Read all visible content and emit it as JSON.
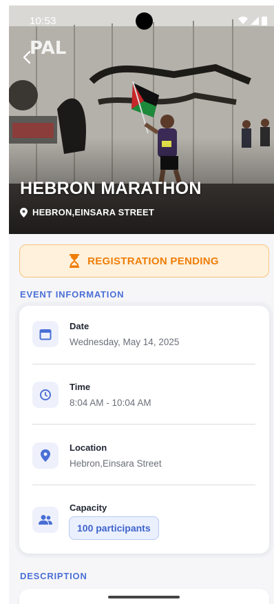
{
  "status_bar": {
    "time": "10:53"
  },
  "event": {
    "title": "HEBRON MARATHON",
    "location": "HEBRON,EINSARA STREET"
  },
  "registration": {
    "status": "REGISTRATION PENDING"
  },
  "sections": {
    "event_info": "EVENT INFORMATION",
    "description": "DESCRIPTION"
  },
  "info": {
    "date": {
      "label": "Date",
      "value": "Wednesday, May 14, 2025",
      "icon": "calendar-icon"
    },
    "time": {
      "label": "Time",
      "value": "8:04 AM - 10:04 AM",
      "icon": "clock-icon"
    },
    "location": {
      "label": "Location",
      "value": "Hebron,Einsara Street",
      "icon": "location-pin-icon"
    },
    "capacity": {
      "label": "Capacity",
      "value": "100 participants",
      "icon": "people-icon"
    }
  },
  "colors": {
    "accent": "#4a6fd6",
    "pending": "#ef7d07",
    "pending_bg": "#fff1dc"
  }
}
